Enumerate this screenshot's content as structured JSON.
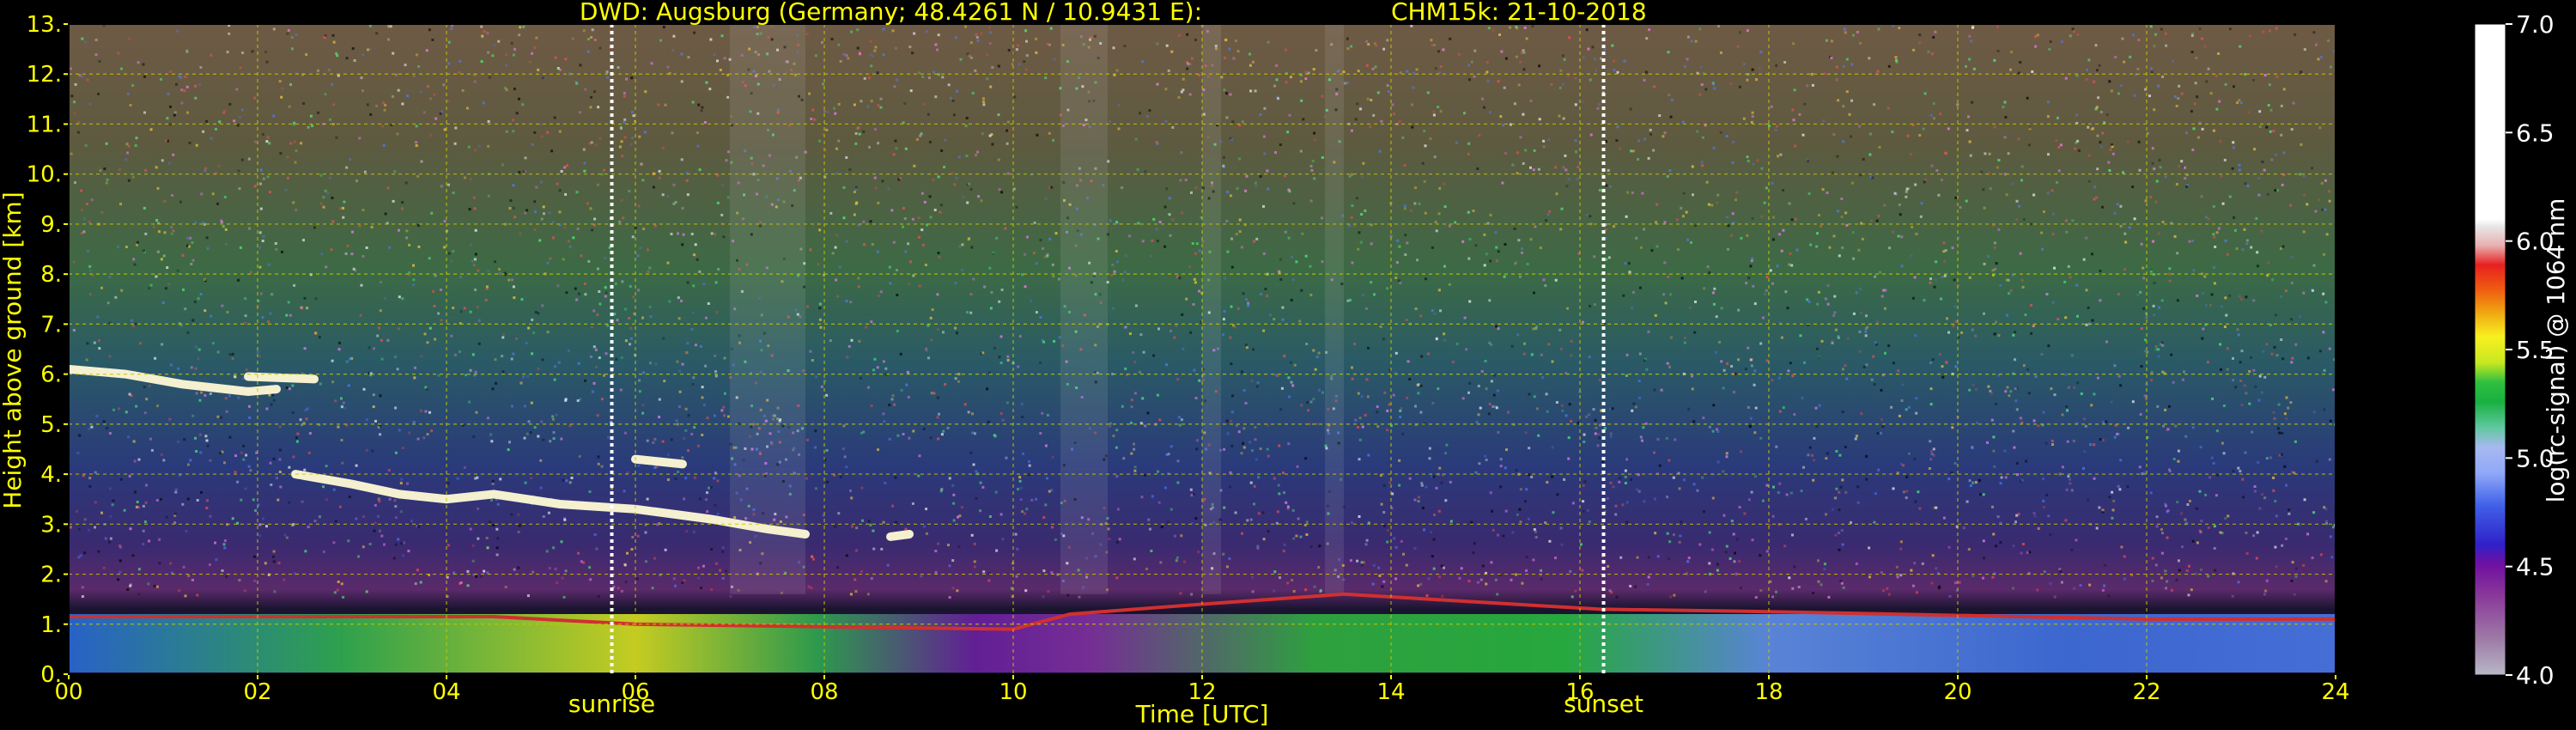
{
  "chart_data": {
    "type": "heatmap",
    "title_left": "DWD: Augsburg (Germany; 48.4261 N / 10.9431 E):",
    "title_right": "CHM15k: 21-10-2018",
    "xlabel": "Time [UTC]",
    "ylabel": "Height above ground [km]",
    "xlim": [
      0,
      24
    ],
    "ylim": [
      0,
      13
    ],
    "x_ticks": [
      "00",
      "02",
      "04",
      "06",
      "08",
      "10",
      "12",
      "14",
      "16",
      "18",
      "20",
      "22",
      "24"
    ],
    "y_ticks": [
      "0.",
      "1.",
      "2.",
      "3.",
      "4.",
      "5.",
      "6.",
      "7.",
      "8.",
      "9.",
      "10.",
      "11.",
      "12.",
      "13."
    ],
    "grid": true,
    "colorbar": {
      "label": "log(rc-signal) @ 1064 nm",
      "range": [
        4.0,
        7.0
      ],
      "ticks": [
        "4.0",
        "4.5",
        "5.0",
        "5.5",
        "6.0",
        "6.5",
        "7.0"
      ]
    },
    "annotations": [
      {
        "label": "sunrise",
        "x": 5.75
      },
      {
        "label": "sunset",
        "x": 16.25
      }
    ],
    "colors": {
      "axis_text": "#ffff00",
      "grid": "#c8c800",
      "background": "#000000"
    }
  }
}
